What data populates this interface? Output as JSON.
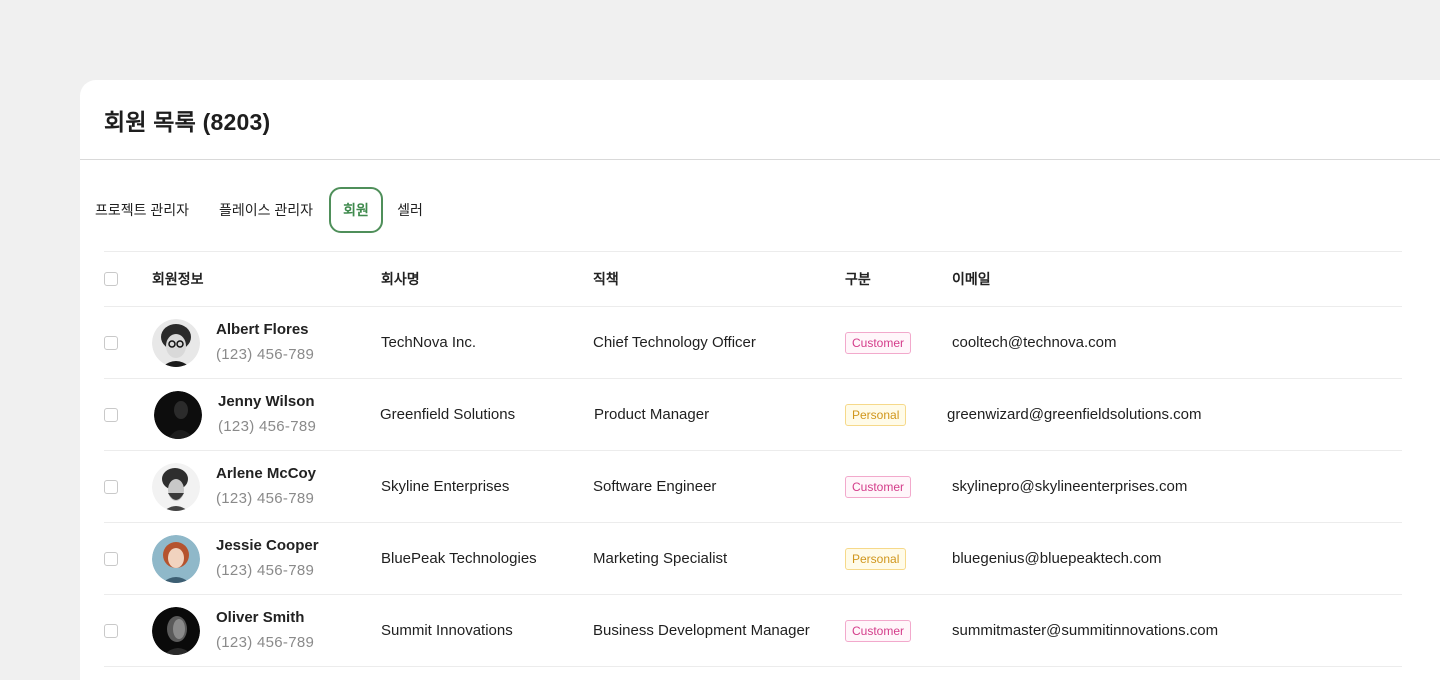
{
  "page": {
    "title": "회원 목록 (8203)"
  },
  "tabs": [
    {
      "label": "프로젝트 관리자",
      "active": false
    },
    {
      "label": "플레이스 관리자",
      "active": false
    },
    {
      "label": "회원",
      "active": true
    },
    {
      "label": "셀러",
      "active": false
    }
  ],
  "table": {
    "columns": {
      "member_info": "회원정보",
      "company": "회사명",
      "position": "직책",
      "category": "구분",
      "email": "이메일"
    },
    "rows": [
      {
        "name": "Albert Flores",
        "phone": "(123) 456-789",
        "company": "TechNova Inc.",
        "position": "Chief Technology Officer",
        "category": "Customer",
        "email": "cooltech@technova.com",
        "avatar": "portrait-curly-glasses"
      },
      {
        "name": "Jenny Wilson",
        "phone": "(123) 456-789",
        "company": "Greenfield Solutions",
        "position": "Product Manager",
        "category": "Personal",
        "email": "greenwizard@greenfieldsolutions.com",
        "avatar": "portrait-dark"
      },
      {
        "name": "Arlene McCoy",
        "phone": "(123) 456-789",
        "company": "Skyline Enterprises",
        "position": "Software Engineer",
        "category": "Customer",
        "email": "skylinepro@skylineenterprises.com",
        "avatar": "portrait-curly-beard"
      },
      {
        "name": "Jessie Cooper",
        "phone": "(123) 456-789",
        "company": "BluePeak Technologies",
        "position": "Marketing Specialist",
        "category": "Personal",
        "email": "bluegenius@bluepeaktech.com",
        "avatar": "portrait-red-hair"
      },
      {
        "name": "Oliver Smith",
        "phone": "(123) 456-789",
        "company": "Summit Innovations",
        "position": "Business Development Manager",
        "category": "Customer",
        "email": "summitmaster@summitinnovations.com",
        "avatar": "portrait-dark-bw"
      }
    ]
  },
  "colors": {
    "accent": "#4f8f5a",
    "customer_badge": "#d43c8a",
    "personal_badge": "#d0961c"
  }
}
